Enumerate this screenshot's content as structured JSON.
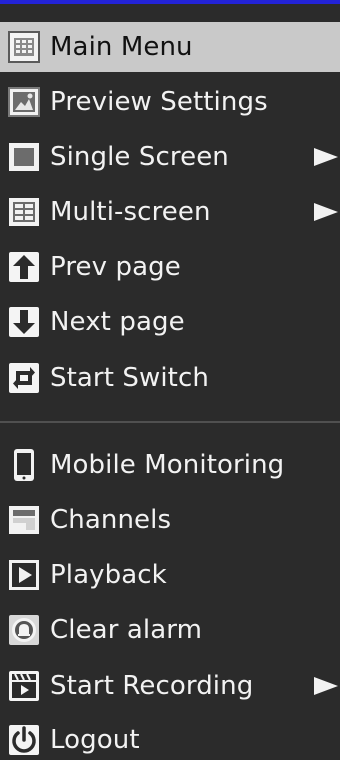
{
  "menu": {
    "items": [
      {
        "label": "Main Menu",
        "icon": "main-menu-icon",
        "selected": true
      },
      {
        "label": "Preview Settings",
        "icon": "preview-settings-icon"
      },
      {
        "label": "Single Screen",
        "icon": "single-screen-icon",
        "submenu": true
      },
      {
        "label": "Multi-screen",
        "icon": "multi-screen-icon",
        "submenu": true
      },
      {
        "label": "Prev page",
        "icon": "arrow-up-icon"
      },
      {
        "label": "Next page",
        "icon": "arrow-down-icon"
      },
      {
        "label": "Start Switch",
        "icon": "switch-icon"
      },
      {
        "label": "Mobile Monitoring",
        "icon": "mobile-icon"
      },
      {
        "label": "Channels",
        "icon": "channels-icon"
      },
      {
        "label": "Playback",
        "icon": "playback-icon"
      },
      {
        "label": "Clear alarm",
        "icon": "alarm-icon"
      },
      {
        "label": "Start Recording",
        "icon": "recording-icon",
        "submenu": true
      },
      {
        "label": "Logout",
        "icon": "power-icon"
      }
    ]
  },
  "colors": {
    "background": "#2b2b2b",
    "selected_background": "#c9c9c9",
    "accent_border": "#2323d8",
    "text": "#f2f2f2"
  }
}
